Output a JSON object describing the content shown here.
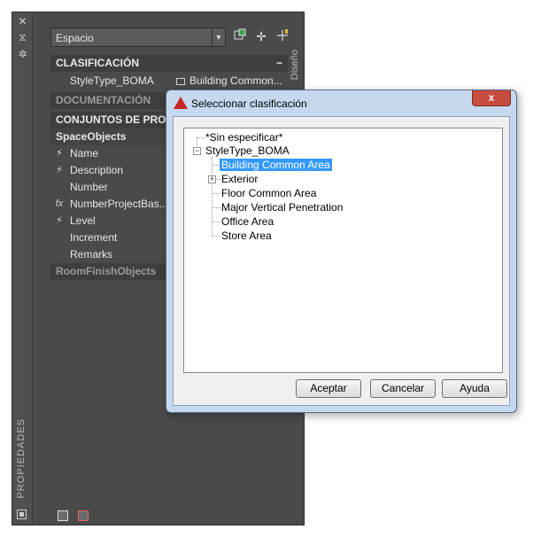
{
  "palette": {
    "side_title": "PROPIEDADES",
    "right_tab": "Diseño",
    "combo_value": "Espacio",
    "sections": {
      "clasificacion": "CLASIFICACIÓN",
      "documentacion": "DOCUMENTACIÓN",
      "conjuntos": "CONJUNTOS DE PROP",
      "space_objects": "SpaceObjects",
      "room_finish": "RoomFinishObjects"
    },
    "clasificacion_row": {
      "label": "StyleType_BOMA",
      "value": "Building  Common..."
    },
    "properties": [
      {
        "label": "Name",
        "icon": "lightning-icon"
      },
      {
        "label": "Description",
        "icon": "lightning-icon"
      },
      {
        "label": "Number",
        "icon": ""
      },
      {
        "label": "NumberProjectBas...",
        "icon": "fx-icon"
      },
      {
        "label": "Level",
        "icon": "lightning-icon"
      },
      {
        "label": "Increment",
        "icon": ""
      },
      {
        "label": "Remarks",
        "icon": ""
      }
    ]
  },
  "dialog": {
    "title": "Seleccionar clasificación",
    "close": "x",
    "tree": {
      "root_unspecified": "*Sin especificar*",
      "root": "StyleType_BOMA",
      "children": [
        "Building Common Area",
        "Exterior",
        "Floor Common Area",
        "Major Vertical Penetration",
        "Office Area",
        "Store Area"
      ],
      "selected": "Building Common Area"
    },
    "buttons": {
      "ok": "Aceptar",
      "cancel": "Cancelar",
      "help": "Ayuda"
    }
  },
  "colors": {
    "palette_bg": "#4a4a4a",
    "selection": "#3399ff",
    "close_button": "#c74b3e"
  }
}
